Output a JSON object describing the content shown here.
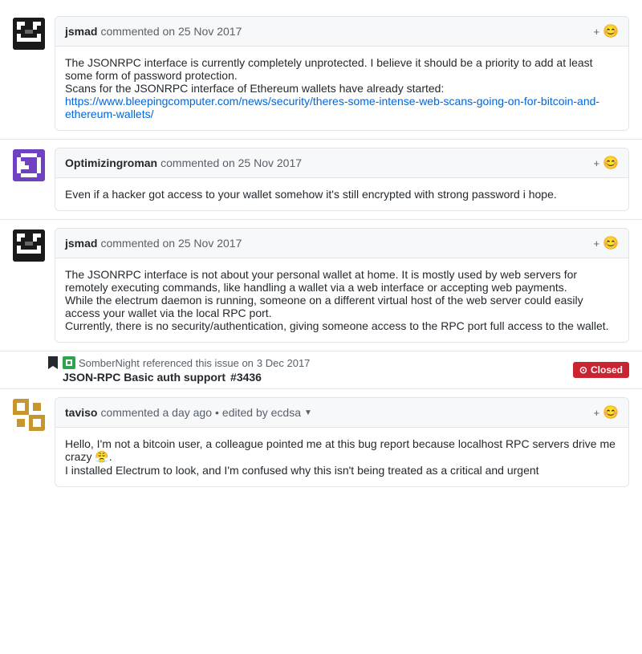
{
  "comments": [
    {
      "id": "comment-1",
      "username": "jsmad",
      "date": "commented on 25 Nov 2017",
      "avatar_type": "jsmad",
      "body": [
        "The JSONRPC interface is currently completely unprotected. I believe it should be a priority to add at least some form of password protection.",
        "Scans for the JSONRPC interface of Ethereum wallets have already started:",
        "https://www.bleepingcomputer.com/news/security/theres-some-intense-web-scans-going-on-for-bitcoin-and-ethereum-wallets/"
      ],
      "has_link": true,
      "link_text": "https://www.bleepingcomputer.com/news/security/theres-some-intense-web-scans-going-on-for-bitcoin-and-ethereum-wallets/",
      "link_url": "#"
    },
    {
      "id": "comment-2",
      "username": "Optimizingroman",
      "date": "commented on 25 Nov 2017",
      "avatar_type": "optimizing",
      "body": [
        "Even if a hacker got access to your wallet somehow it's still encrypted with strong password i hope."
      ],
      "has_link": false
    },
    {
      "id": "comment-3",
      "username": "jsmad",
      "date": "commented on 25 Nov 2017",
      "avatar_type": "jsmad",
      "body": [
        "The JSONRPC interface is not about your personal wallet at home. It is mostly used by web servers for remotely executing commands, like handling a wallet via a web interface or accepting web payments.",
        "While the electrum daemon is running, someone on a different virtual host of the web server could easily access your wallet via the local RPC port.",
        "Currently, there is no security/authentication, giving someone access to the RPC port full access to the wallet."
      ],
      "has_link": false
    }
  ],
  "reference": {
    "username": "SomberNight",
    "action": "referenced this issue on",
    "date": "3 Dec 2017",
    "issue_title": "JSON-RPC Basic auth support",
    "issue_number": "#3436",
    "status": "Closed"
  },
  "last_comment": {
    "id": "comment-4",
    "username": "taviso",
    "date": "commented a day ago",
    "edited_by": "edited by ecdsa",
    "avatar_type": "taviso",
    "body": [
      "Hello, I'm not a bitcoin user, a colleague pointed me at this bug report because localhost RPC servers drive me crazy 😤.",
      "I installed Electrum to look, and I'm confused why this isn't being treated as a critical and urgent"
    ],
    "has_link": false
  },
  "labels": {
    "plus": "+",
    "emoji": "😊",
    "closed": "Closed",
    "circle_icon": "⊙"
  }
}
